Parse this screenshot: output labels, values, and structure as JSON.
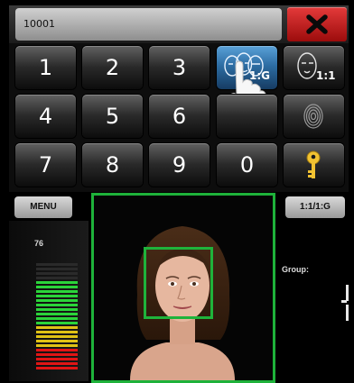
{
  "user_id_input": {
    "value": "10001"
  },
  "close_button": {
    "icon": "close-icon",
    "color": "#c11818"
  },
  "keypad": {
    "keys": [
      {
        "label": "1"
      },
      {
        "label": "2"
      },
      {
        "label": "3"
      },
      {
        "icon": "face-group-icon",
        "sub_label": "1:G"
      },
      {
        "icon": "face-single-icon",
        "sub_label": "1:1"
      },
      {
        "label": "4"
      },
      {
        "label": "5"
      },
      {
        "label": "6"
      },
      {
        "icon": "fingerprint-icon"
      },
      {
        "label": "7"
      },
      {
        "label": "8"
      },
      {
        "label": "9"
      },
      {
        "label": "0"
      },
      {
        "icon": "key-icon"
      }
    ]
  },
  "menu_button": {
    "label": "MENU"
  },
  "mode_button": {
    "label": "1:1/1:G"
  },
  "match_score": {
    "value": "76"
  },
  "quality_meter": {
    "colors": [
      "#e01515",
      "#e0c215",
      "#2bd43a"
    ]
  },
  "group": {
    "label": "Group:"
  },
  "detection_color": "#1eb23a"
}
